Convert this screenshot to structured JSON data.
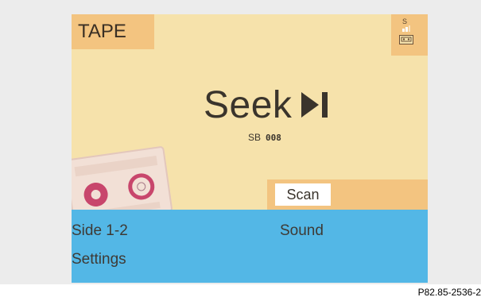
{
  "source": {
    "label": "TAPE"
  },
  "status": {
    "s_label": "S"
  },
  "display": {
    "mode_label": "Seek",
    "mode_icon": "skip-forward-icon",
    "sub_prefix": "SB",
    "sub_digits": "008"
  },
  "scan": {
    "label": "Scan"
  },
  "menu": {
    "side_label": "Side 1-2",
    "sound_label": "Sound",
    "settings_label": "Settings"
  },
  "footer": {
    "code": "P82.85-2536-2"
  },
  "colors": {
    "screen_bg": "#f6e2ab",
    "accent": "#f3c480",
    "menu_bg": "#53b7e6",
    "text": "#3a342c"
  }
}
